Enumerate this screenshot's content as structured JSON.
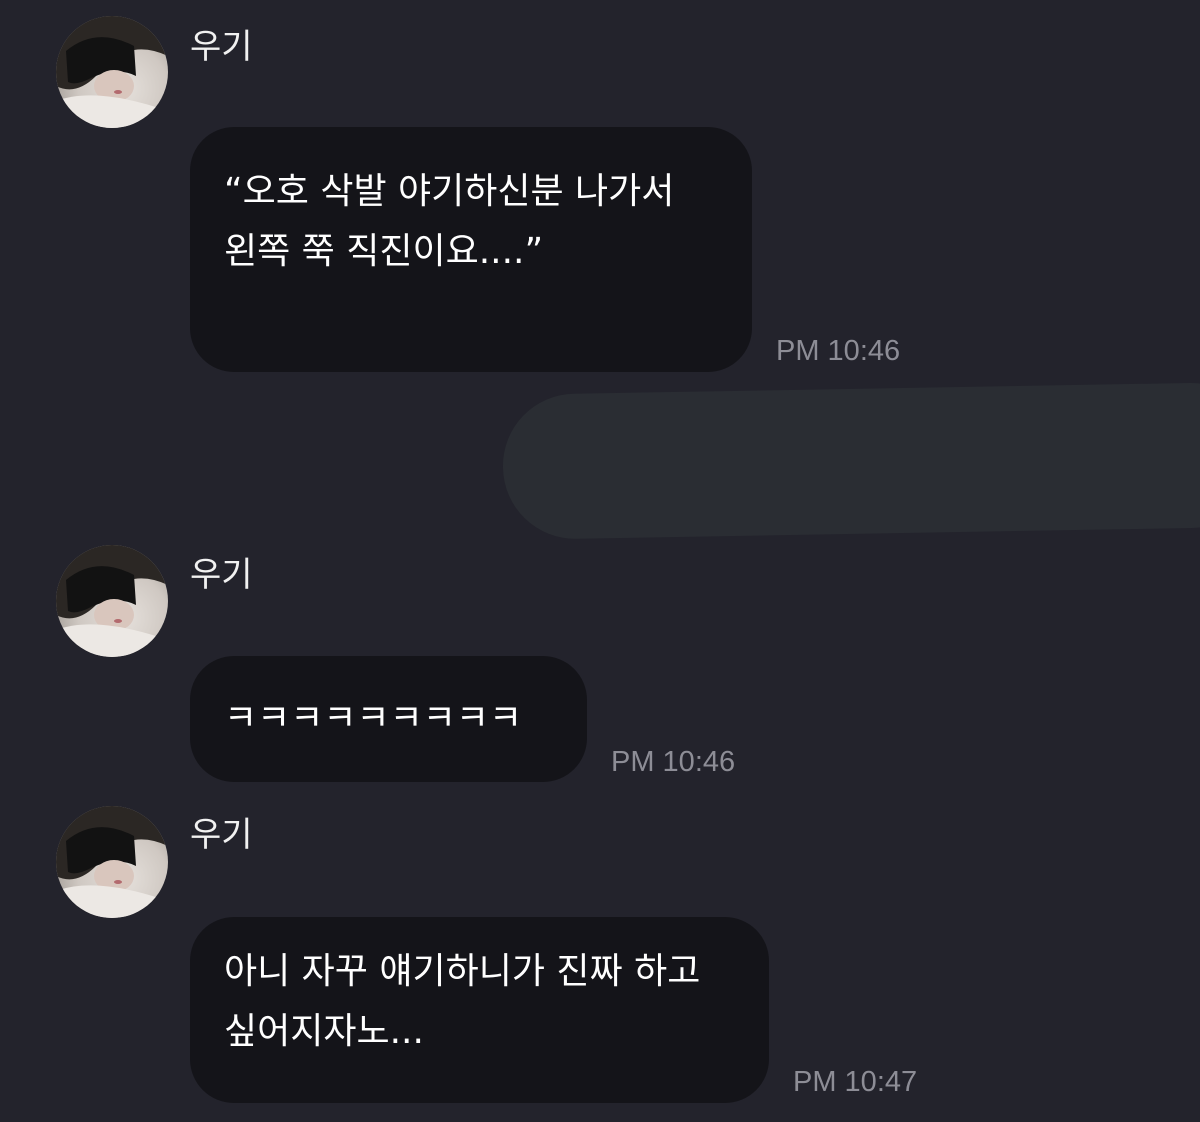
{
  "messages": [
    {
      "sender": "우기",
      "lines": [
        "“오호 삭발 야기하신분 나가서",
        "왼쪽 쭉 직진이요....”"
      ],
      "time": "PM 10:46"
    },
    {
      "sender": "우기",
      "lines": [
        "ㅋㅋㅋㅋㅋㅋㅋㅋㅋ"
      ],
      "time": "PM 10:46"
    },
    {
      "sender": "우기",
      "lines": [
        "아니 자꾸 얘기하니가 진짜 하고",
        "싶어지자노..."
      ],
      "time": "PM 10:47"
    }
  ],
  "colors": {
    "background": "#23232c",
    "bubble": "#141419",
    "timestamp": "#8d8d96",
    "redacted_bubble": "#2a2d33"
  },
  "icons": {
    "avatar": "profile-photo"
  }
}
